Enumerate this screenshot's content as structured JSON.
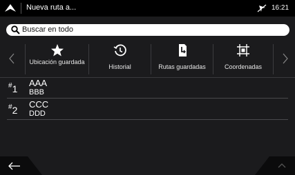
{
  "topbar": {
    "title": "Nueva ruta a...",
    "time": "16:21",
    "nav_icon": "navigation-arrow-icon",
    "gps_icon": "gps-off-icon"
  },
  "search": {
    "placeholder": "Buscar en todo",
    "icon": "search-icon"
  },
  "tabs": [
    {
      "label": "Ubicación guardada",
      "icon": "star-icon"
    },
    {
      "label": "Historial",
      "icon": "history-icon"
    },
    {
      "label": "Rutas guardadas",
      "icon": "saved-routes-icon"
    },
    {
      "label": "Coordenadas",
      "icon": "coordinates-icon"
    }
  ],
  "results": [
    {
      "index": "1",
      "prefix": "#",
      "line1": "AAA",
      "line2": "BBB"
    },
    {
      "index": "2",
      "prefix": "#",
      "line1": "CCC",
      "line2": "DDD"
    }
  ],
  "footer": {
    "back_icon": "back-arrow-icon",
    "up_icon": "chevron-up-icon"
  },
  "colors": {
    "background": "#1b1b1d",
    "topbar": "#000000",
    "search_bg": "#ffffff",
    "divider": "#3a3a3d"
  }
}
